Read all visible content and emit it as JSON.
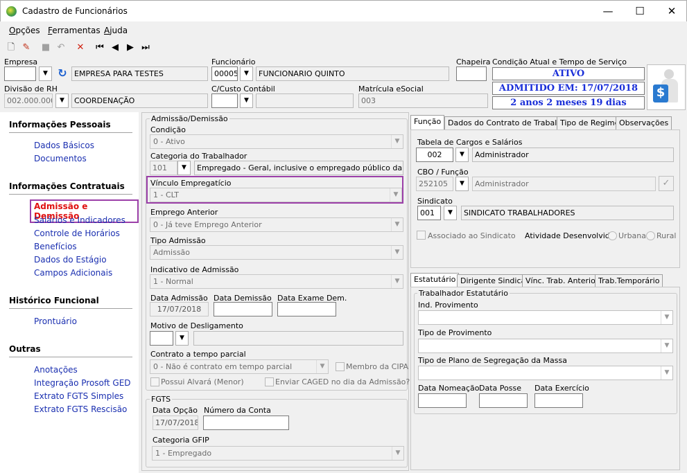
{
  "window": {
    "title": "Cadastro de Funcionários",
    "min": "—",
    "max": "☐",
    "close": "✕"
  },
  "menu": [
    {
      "label": "Opções",
      "u": "O"
    },
    {
      "label": "Ferramentas",
      "u": "F"
    },
    {
      "label": "Ajuda",
      "u": "A"
    }
  ],
  "toolbar": {
    "new": "🗋",
    "edit": "✎",
    "stop": "■",
    "undo": "↶",
    "delete": "✕",
    "first": "⏮",
    "prev": "◀",
    "next": "▶",
    "last": "⏭"
  },
  "header": {
    "empresa_label": "Empresa",
    "empresa_code": "",
    "empresa_name": "EMPRESA PARA TESTES",
    "funcionario_label": "Funcionário",
    "funcionario_code": "00005",
    "funcionario_name": "FUNCIONARIO QUINTO",
    "chapeira_label": "Chapeira",
    "chapeira_value": "",
    "condicao_label": "Condição Atual e Tempo de Serviço",
    "status1": "ATIVO",
    "status2": "ADMITIDO EM: 17/07/2018",
    "status3": "2 anos 2 meses 19 dias",
    "divisao_label": "Divisão de RH",
    "divisao_code": "002.000.000",
    "divisao_name": "COORDENAÇÃO",
    "ccusto_label": "C/Custo Contábil",
    "ccusto_code": "",
    "ccusto_name": "",
    "matricula_label": "Matrícula eSocial",
    "matricula_value": "003"
  },
  "sidebar": {
    "sections": [
      {
        "title": "Informações Pessoais",
        "items": [
          "Dados Básicos",
          "Documentos"
        ]
      },
      {
        "title": "Informações Contratuais",
        "items": [
          "Admissão e Demissão",
          "Salários e Indicadores",
          "Controle de Horários",
          "Benefícios",
          "Dados do Estágio",
          "Campos Adicionais"
        ]
      },
      {
        "title": "Histórico Funcional",
        "items": [
          "Prontuário"
        ]
      },
      {
        "title": "Outras",
        "items": [
          "Anotações",
          "Integração Prosoft GED",
          "Extrato FGTS Simples",
          "Extrato FGTS Rescisão"
        ]
      }
    ],
    "active_color": "#e01010"
  },
  "admissao": {
    "group_title": "Admissão/Demissão",
    "condicao_label": "Condição",
    "condicao_value": "0 - Ativo",
    "categoria_label": "Categoria do Trabalhador",
    "categoria_code": "101",
    "categoria_desc": "Empregado - Geral, inclusive o empregado público da administ",
    "vinculo_label": "Vínculo Empregatício",
    "vinculo_value": "1 - CLT",
    "emprego_label": "Emprego Anterior",
    "emprego_value": "0 - Já teve Emprego Anterior",
    "tipo_label": "Tipo Admissão",
    "tipo_value": "Admissão",
    "indicativo_label": "Indicativo de Admissão",
    "indicativo_value": "1 - Normal",
    "data_adm_label": "Data Admissão",
    "data_adm_value": "17/07/2018",
    "data_dem_label": "Data Demissão",
    "data_dem_value": "",
    "data_exame_label": "Data Exame Dem.",
    "data_exame_value": "",
    "motivo_label": "Motivo de Desligamento",
    "motivo_code": "",
    "motivo_desc": "",
    "contrato_label": "Contrato a tempo parcial",
    "contrato_value": "0 - Não é contrato em tempo parcial",
    "membro_cipa": "Membro da CIPA",
    "alvara": "Possui Alvará (Menor)",
    "caged": "Enviar CAGED no dia da Admissão?"
  },
  "fgts": {
    "group_title": "FGTS",
    "data_opcao_label": "Data Opção",
    "data_opcao_value": "17/07/2018",
    "conta_label": "Número da Conta",
    "conta_value": "",
    "gfip_label": "Categoria GFIP",
    "gfip_value": "1 - Empregado"
  },
  "tabs_top": [
    "Função",
    "Dados do Contrato de Trabalho",
    "Tipo de Regime",
    "Observações"
  ],
  "funcao": {
    "tabela_label": "Tabela de Cargos e Salários",
    "tabela_code": "002",
    "tabela_desc": "Administrador",
    "cbo_label": "CBO / Função",
    "cbo_code": "252105",
    "cbo_desc": "Administrador",
    "sindicato_label": "Sindicato",
    "sindicato_code": "001",
    "sindicato_desc": "SINDICATO TRABALHADORES",
    "associado": "Associado ao Sindicato",
    "atividade_label": "Atividade Desenvolvida:",
    "urbana": "Urbana",
    "rural": "Rural"
  },
  "tabs_bottom": [
    "Estatutário",
    "Dirigente Sindical",
    "Vínc. Trab. Anterior",
    "Trab.Temporário"
  ],
  "estatutario": {
    "group_title": "Trabalhador Estatutário",
    "ind_label": "Ind. Provimento",
    "tipo_prov_label": "Tipo de Provimento",
    "plano_label": "Tipo de Plano de Segregação da Massa",
    "nomeacao_label": "Data Nomeação",
    "posse_label": "Data Posse",
    "exercicio_label": "Data Exercício"
  },
  "colors": {
    "highlight": "#9b3fa8",
    "status_text": "#1a2fd8",
    "link": "#1a2fb0"
  }
}
